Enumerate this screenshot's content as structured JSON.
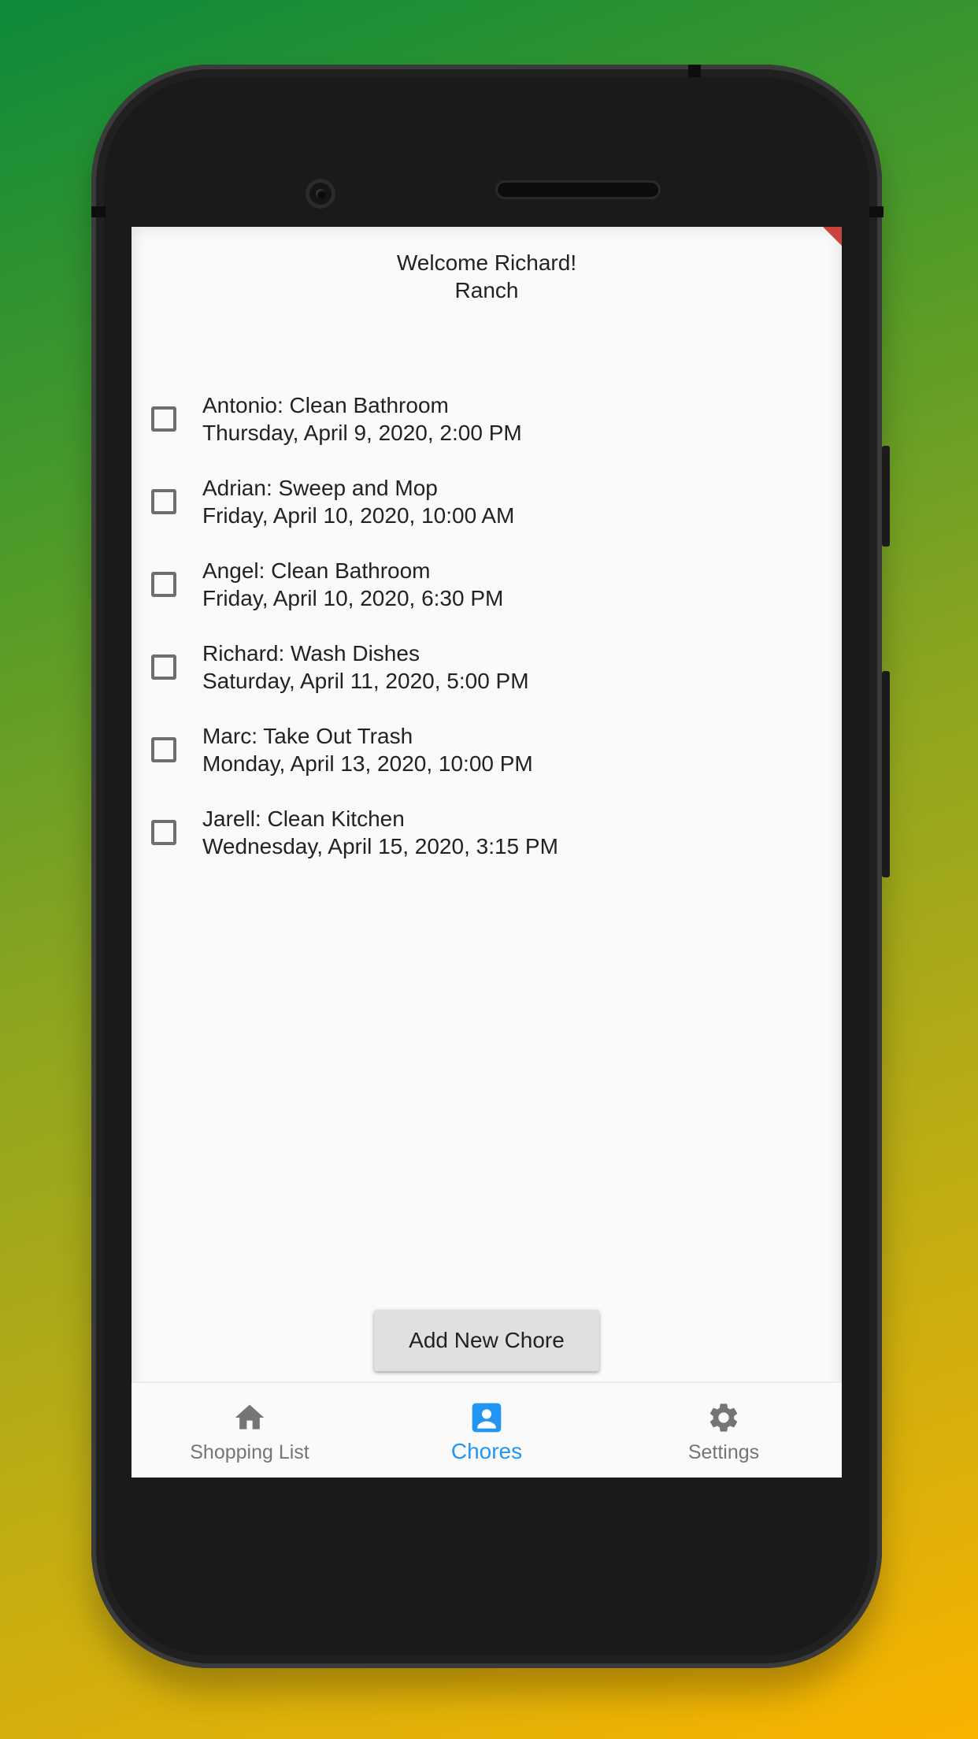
{
  "header": {
    "welcome": "Welcome Richard!",
    "group": "Ranch"
  },
  "chores": [
    {
      "title": "Antonio: Clean Bathroom",
      "due": "Thursday, April 9, 2020, 2:00 PM",
      "checked": false
    },
    {
      "title": "Adrian: Sweep and Mop",
      "due": "Friday, April 10, 2020, 10:00 AM",
      "checked": false
    },
    {
      "title": "Angel: Clean Bathroom",
      "due": "Friday, April 10, 2020, 6:30 PM",
      "checked": false
    },
    {
      "title": "Richard: Wash Dishes",
      "due": "Saturday, April 11, 2020, 5:00 PM",
      "checked": false
    },
    {
      "title": "Marc: Take Out Trash",
      "due": "Monday, April 13, 2020, 10:00 PM",
      "checked": false
    },
    {
      "title": "Jarell: Clean Kitchen",
      "due": "Wednesday, April 15, 2020, 3:15 PM",
      "checked": false
    }
  ],
  "add_button": {
    "label": "Add New Chore"
  },
  "bottom_nav": {
    "items": [
      {
        "label": "Shopping List",
        "icon": "home-icon",
        "active": false
      },
      {
        "label": "Chores",
        "icon": "person-badge-icon",
        "active": true
      },
      {
        "label": "Settings",
        "icon": "gear-icon",
        "active": false
      }
    ]
  },
  "colors": {
    "accent": "#2196f3",
    "inactive": "#757575",
    "background": "#fafafa",
    "button": "#e0e0e0"
  }
}
